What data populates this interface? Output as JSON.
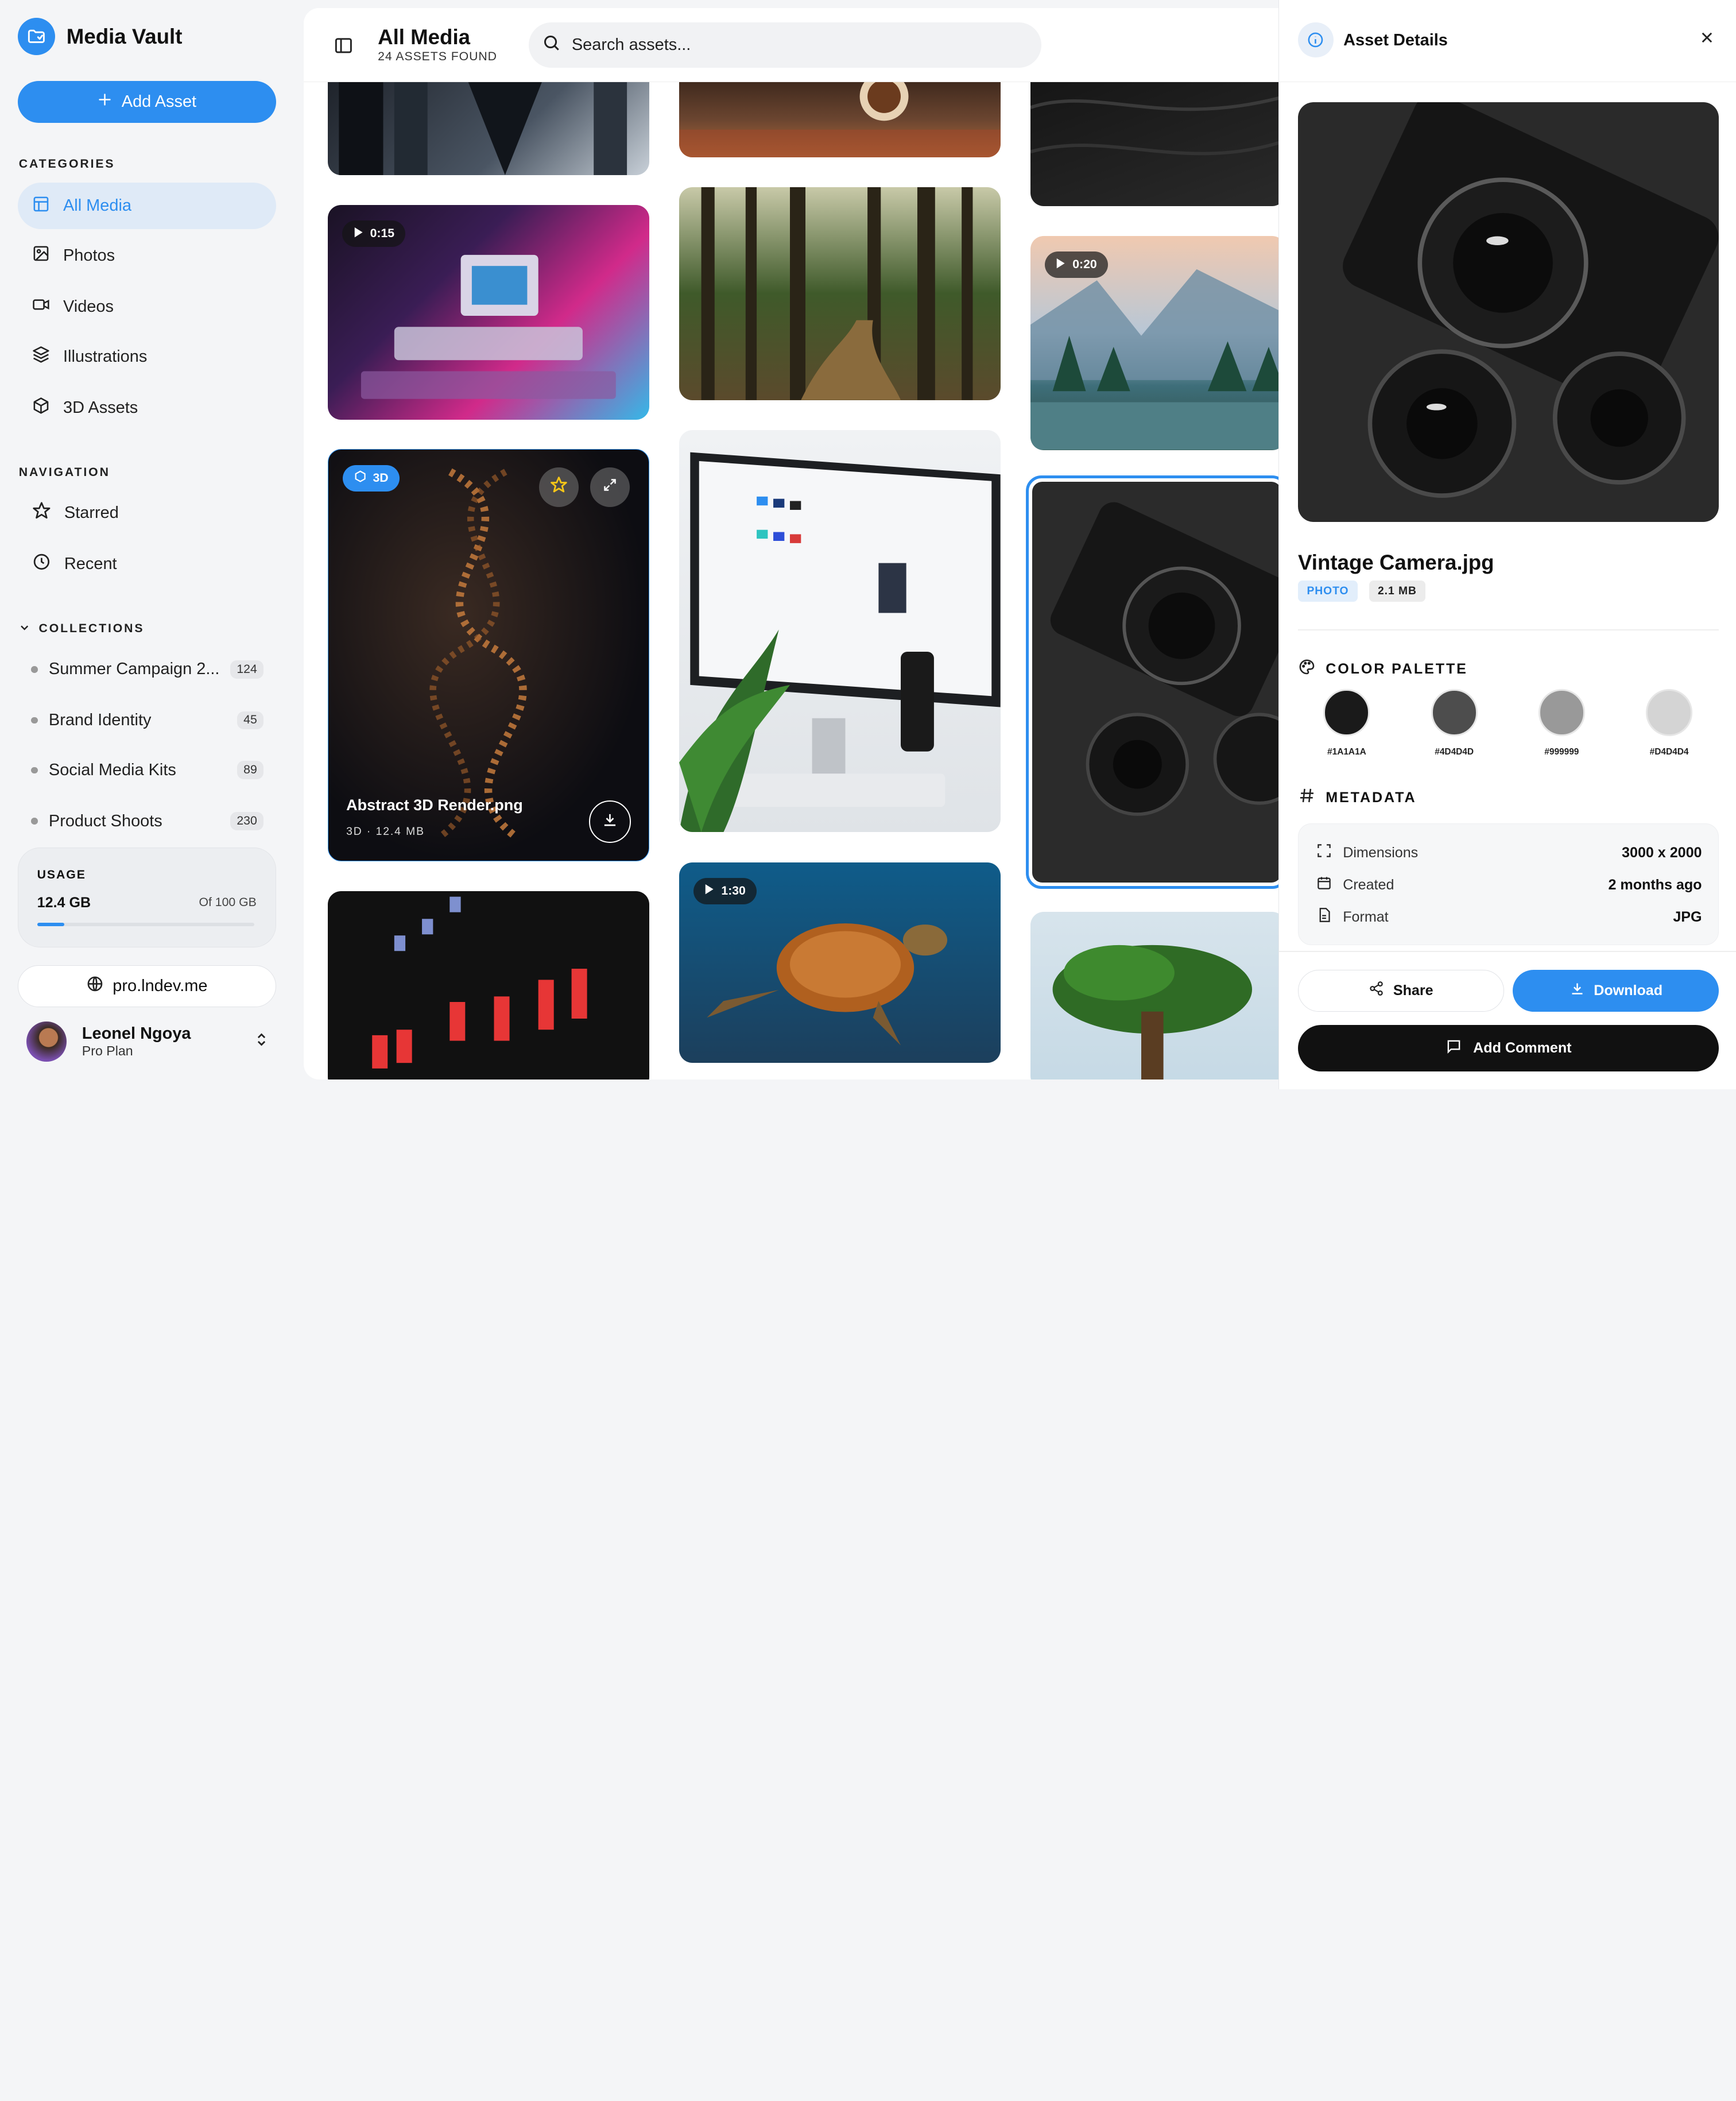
{
  "app": {
    "name": "Media Vault",
    "add_label": "Add Asset"
  },
  "sidebar": {
    "categories_title": "CATEGORIES",
    "categories": [
      {
        "label": "All Media",
        "icon": "layout-icon"
      },
      {
        "label": "Photos",
        "icon": "image-icon"
      },
      {
        "label": "Videos",
        "icon": "video-icon"
      },
      {
        "label": "Illustrations",
        "icon": "layers-icon"
      },
      {
        "label": "3D Assets",
        "icon": "cube-icon"
      }
    ],
    "navigation_title": "NAVIGATION",
    "navigation": [
      {
        "label": "Starred",
        "icon": "star-icon"
      },
      {
        "label": "Recent",
        "icon": "clock-icon"
      }
    ],
    "collections_title": "COLLECTIONS",
    "collections": [
      {
        "label": "Summer Campaign 2...",
        "count": "124"
      },
      {
        "label": "Brand Identity",
        "count": "45"
      },
      {
        "label": "Social Media Kits",
        "count": "89"
      },
      {
        "label": "Product Shoots",
        "count": "230"
      }
    ],
    "usage": {
      "title": "USAGE",
      "used": "12.4 GB",
      "total": "Of 100 GB",
      "fraction": 0.124
    },
    "site": "pro.lndev.me",
    "user": {
      "name": "Leonel Ngoya",
      "plan": "Pro Plan"
    }
  },
  "header": {
    "title": "All Media",
    "subtitle": "24 ASSETS FOUND",
    "search_placeholder": "Search assets..."
  },
  "grid": {
    "video_durations": [
      "0:15",
      "0:20",
      "1:30"
    ],
    "featured": {
      "badge": "3D",
      "name": "Abstract 3D Render.png",
      "meta": "3D · 12.4 MB"
    }
  },
  "detail": {
    "title": "Asset Details",
    "name": "Vintage Camera.jpg",
    "type": "PHOTO",
    "size": "2.1 MB",
    "palette_title": "COLOR PALETTE",
    "palette": [
      {
        "label": "#1A1A1A",
        "color": "#1A1A1A"
      },
      {
        "label": "#4D4D4D",
        "color": "#4D4D4D"
      },
      {
        "label": "#999999",
        "color": "#999999"
      },
      {
        "label": "#D4D4D4",
        "color": "#D4D4D4"
      }
    ],
    "metadata_title": "METADATA",
    "metadata": [
      {
        "key": "Dimensions",
        "value": "3000 x 2000"
      },
      {
        "key": "Created",
        "value": "2 months ago"
      },
      {
        "key": "Format",
        "value": "JPG"
      }
    ],
    "share": "Share",
    "download": "Download",
    "comment": "Add Comment"
  },
  "colors": {
    "accent": "#2d8ef0"
  }
}
